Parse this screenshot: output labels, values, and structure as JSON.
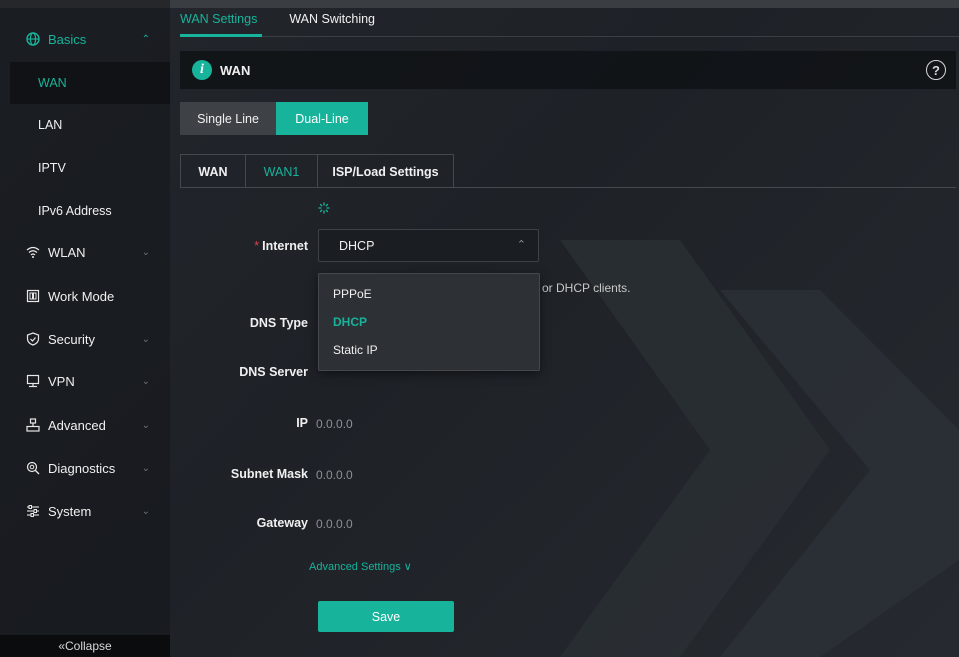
{
  "sidebar": {
    "groups": [
      {
        "label": "Basics",
        "icon": "globe-icon",
        "expanded": true
      },
      {
        "label": "WLAN",
        "icon": "wifi-icon"
      },
      {
        "label": "Work Mode",
        "icon": "work-mode-icon"
      },
      {
        "label": "Security",
        "icon": "shield-icon"
      },
      {
        "label": "VPN",
        "icon": "vpn-icon"
      },
      {
        "label": "Advanced",
        "icon": "advanced-icon"
      },
      {
        "label": "Diagnostics",
        "icon": "diagnostics-icon"
      },
      {
        "label": "System",
        "icon": "system-icon"
      }
    ],
    "basics_items": [
      {
        "label": "WAN",
        "active": true
      },
      {
        "label": "LAN"
      },
      {
        "label": "IPTV"
      },
      {
        "label": "IPv6 Address"
      }
    ],
    "collapse_label": "«Collapse"
  },
  "top_tabs": [
    {
      "label": "WAN Settings",
      "active": true
    },
    {
      "label": "WAN Switching"
    }
  ],
  "section": {
    "title": "WAN",
    "info_glyph": "i",
    "help_glyph": "?"
  },
  "line_mode": {
    "single_label": "Single Line",
    "dual_label": "Dual-Line",
    "selected": "Dual-Line"
  },
  "sub_tabs": [
    {
      "label": "WAN"
    },
    {
      "label": "WAN1",
      "active": true
    },
    {
      "label": "ISP/Load Settings"
    }
  ],
  "form": {
    "internet": {
      "label": "Internet",
      "required_mark": "*",
      "value": "DHCP"
    },
    "internet_options": [
      {
        "label": "PPPoE"
      },
      {
        "label": "DHCP",
        "selected": true
      },
      {
        "label": "Static IP"
      }
    ],
    "hint_partial": "or DHCP clients.",
    "dns_type_label": "DNS Type",
    "dns_server_label": "DNS Server",
    "ip": {
      "label": "IP",
      "value": "0.0.0.0"
    },
    "subnet_mask": {
      "label": "Subnet Mask",
      "value": "0.0.0.0"
    },
    "gateway": {
      "label": "Gateway",
      "value": "0.0.0.0"
    },
    "advanced_settings_label": "Advanced Settings ∨",
    "save_label": "Save"
  },
  "colors": {
    "accent": "#18b39b",
    "required": "#e0454a"
  }
}
